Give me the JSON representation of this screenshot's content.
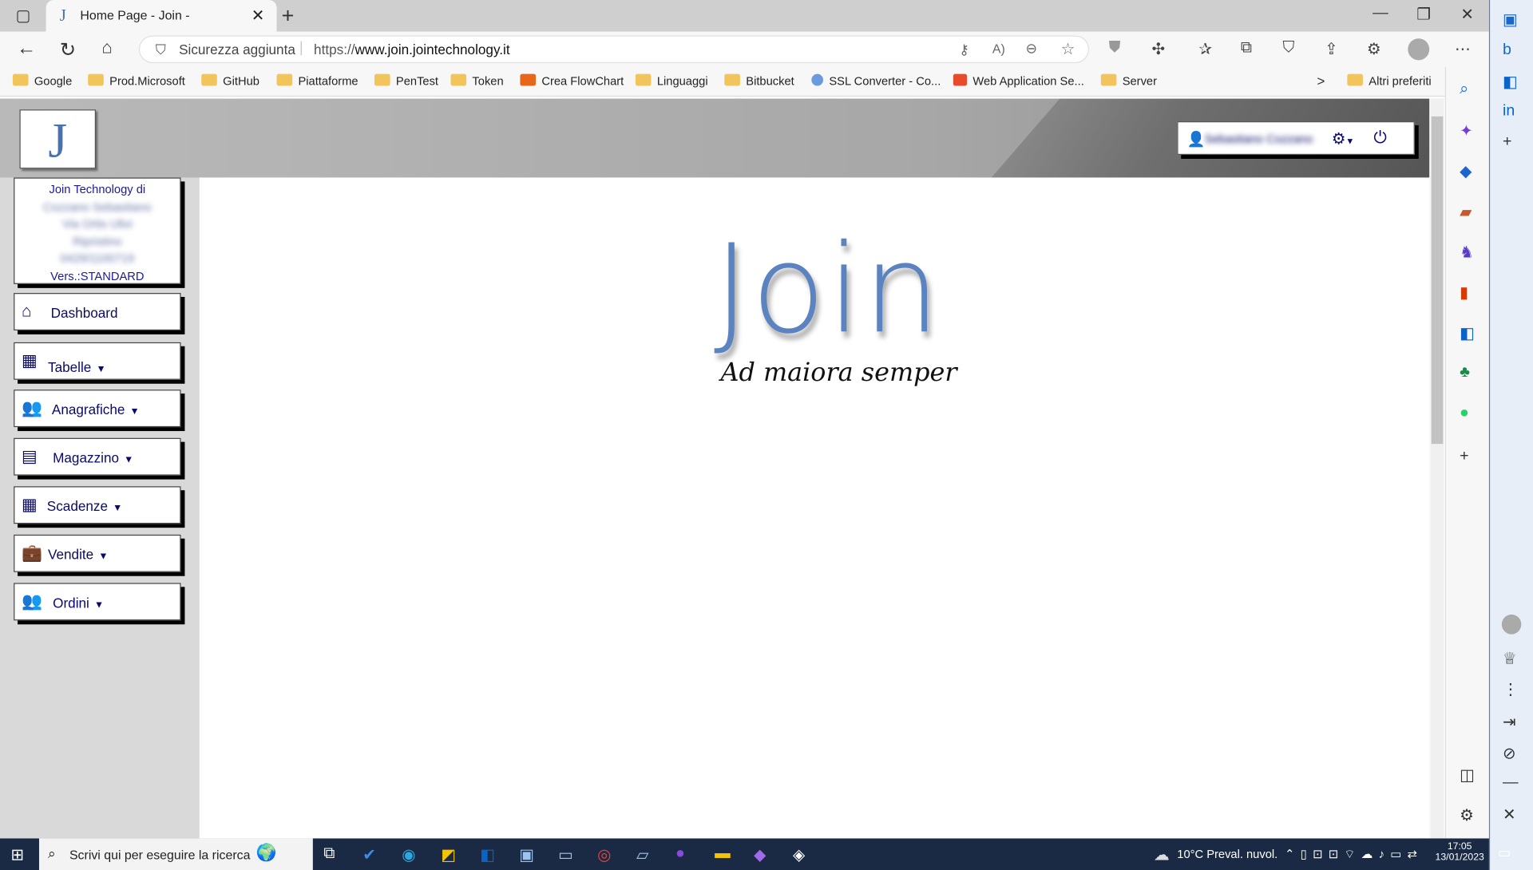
{
  "tab": {
    "title": "Home Page - Join -",
    "close": "✕",
    "new": "+"
  },
  "window": {
    "min": "—",
    "max": "❐",
    "close": "✕"
  },
  "address": {
    "security": "Sicurezza aggiunta",
    "url_prefix": "https://",
    "url_domain": "www.join.jointechnology.it"
  },
  "bookmarks": [
    "Google",
    "Prod.Microsoft",
    "GitHub",
    "Piattaforme",
    "PenTest",
    "Token",
    "Crea FlowChart",
    "Linguaggi",
    "Bitbucket",
    "SSL Converter - Co...",
    "Web Application Se...",
    "Server"
  ],
  "bookmarks_more": ">",
  "other_favorites": "Altri preferiti",
  "app": {
    "logo": "J",
    "company": {
      "line1": "Join Technology di",
      "line2": "Cozzano Sebastiano",
      "line3": "Via Ortis Ulivi",
      "line4": "Ripristino",
      "line5": "0429/1100719",
      "version": "Vers.:STANDARD"
    },
    "user": {
      "name": "Sebastiano Cozzano"
    },
    "menu": [
      {
        "label": "Dashboard",
        "caret": ""
      },
      {
        "label": "Tabelle",
        "caret": "▼"
      },
      {
        "label": "Anagrafiche",
        "caret": "▼"
      },
      {
        "label": "Magazzino",
        "caret": "▼"
      },
      {
        "label": "Scadenze",
        "caret": "▼"
      },
      {
        "label": "Vendite",
        "caret": "▼"
      },
      {
        "label": "Ordini",
        "caret": "▼"
      }
    ],
    "brand": "Join",
    "motto": "Ad maiora semper"
  },
  "taskbar": {
    "search_placeholder": "Scrivi qui per eseguire la ricerca",
    "weather": "10°C  Preval. nuvol.",
    "time": "17:05",
    "date": "13/01/2023"
  },
  "colors": {
    "accent": "#5b83c0",
    "menu_text": "#0a0a6a",
    "taskbar": "#1a2a44",
    "header": "#a7a7a7"
  }
}
